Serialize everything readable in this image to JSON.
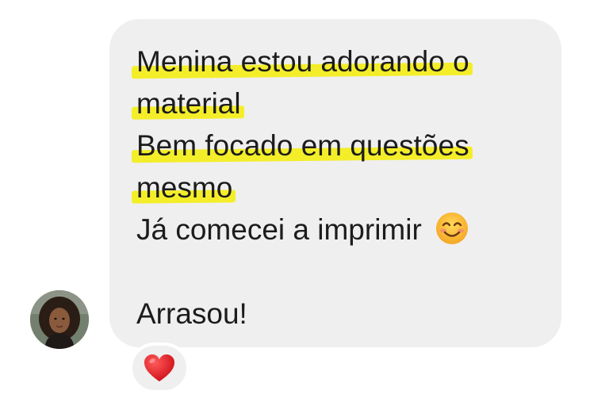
{
  "message": {
    "lines": [
      {
        "text": "Menina estou adorando o",
        "highlighted": true
      },
      {
        "text": "material",
        "highlighted": true
      },
      {
        "text": "Bem focado em questões",
        "highlighted": true
      },
      {
        "text": "mesmo",
        "highlighted": true
      },
      {
        "text": "Já comecei a imprimir",
        "highlighted": false,
        "emoji": "smiling-face-emoji"
      },
      {
        "text": "",
        "highlighted": false
      },
      {
        "text": "Arrasou!",
        "highlighted": false
      }
    ],
    "highlight_color": "#f4ee2a",
    "bubble_color": "#efefef"
  },
  "reaction": {
    "emoji": "red-heart",
    "color": "#e0202a"
  },
  "sender": {
    "avatar": "profile-photo"
  }
}
